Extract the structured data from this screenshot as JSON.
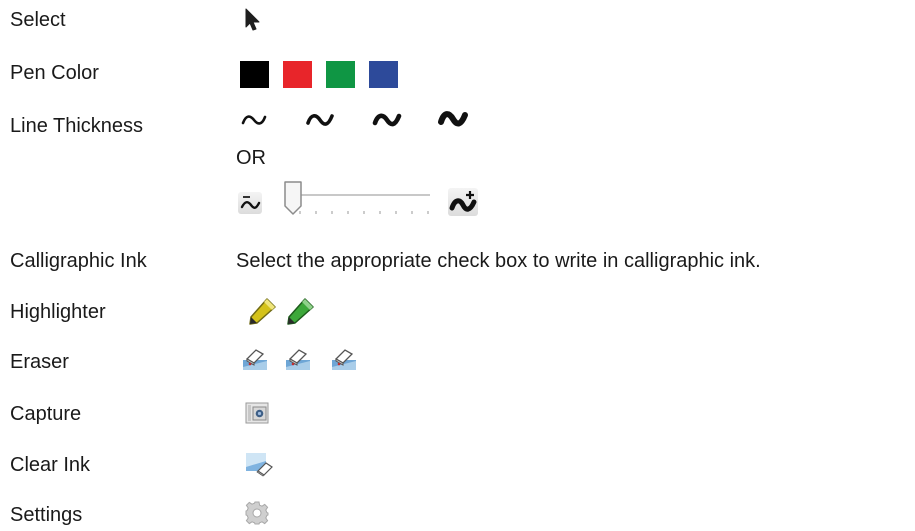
{
  "rows": [
    {
      "label": "Select",
      "icon": "cursor-arrow-icon"
    },
    {
      "label": "Pen Color",
      "colors": [
        "#000000",
        "#e8252a",
        "#0f9644",
        "#2d4a9a"
      ],
      "icon": "pen-color-swatches"
    },
    {
      "label": "Line Thickness",
      "icons": [
        "line-thin-icon",
        "line-medium-icon",
        "line-thick-icon",
        "line-thickest-icon"
      ],
      "or_text": "OR",
      "slider": {
        "level": 0.0,
        "icons": [
          "thickness-decrease-icon",
          "thickness-increase-icon"
        ]
      }
    },
    {
      "label": "Calligraphic Ink",
      "text": "Select the appropriate check box to write in calligraphic ink."
    },
    {
      "label": "Highlighter",
      "icons": [
        "yellow-highlighter-icon",
        "green-highlighter-icon"
      ]
    },
    {
      "label": "Eraser",
      "icons": [
        "eraser-small-icon",
        "eraser-medium-icon",
        "eraser-large-icon"
      ]
    },
    {
      "label": "Capture",
      "icon": "camera-capture-icon"
    },
    {
      "label": "Clear Ink",
      "icon": "clear-ink-icon"
    },
    {
      "label": "Settings",
      "icon": "gear-icon"
    }
  ],
  "colors": {
    "black": "#000000",
    "red": "#e8252a",
    "green": "#0f9644",
    "blue": "#2d4a9a"
  }
}
